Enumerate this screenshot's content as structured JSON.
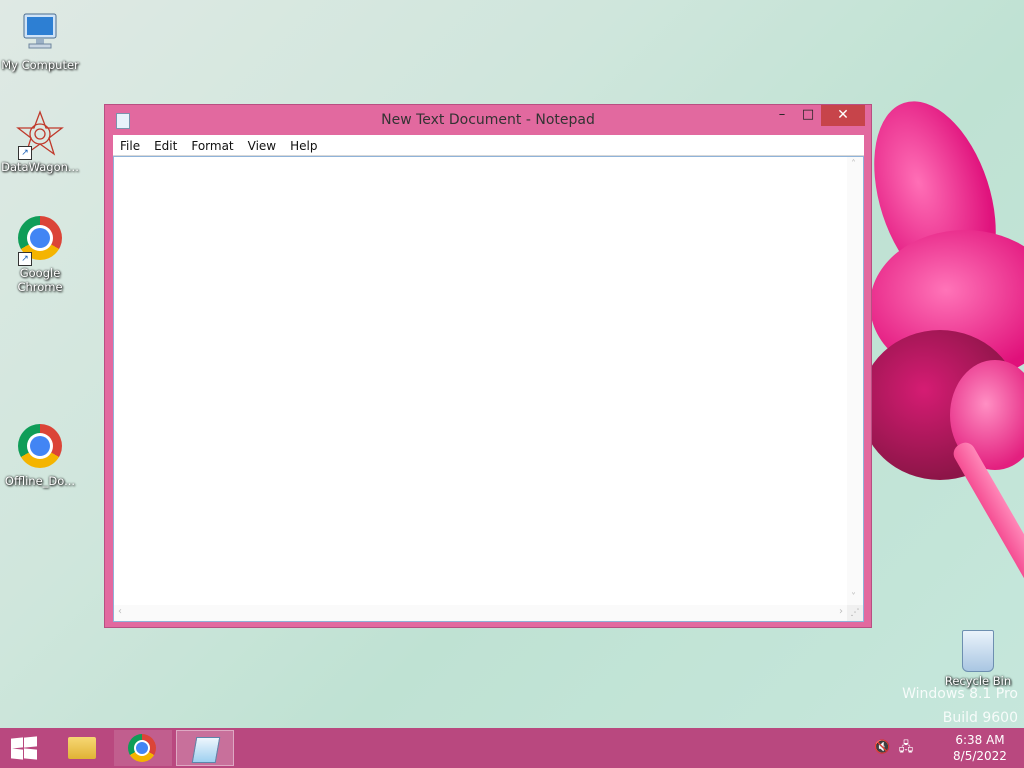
{
  "desktop": {
    "icons": [
      {
        "label": "My Computer",
        "icon": "computer-icon"
      },
      {
        "label": "DataWagon...",
        "icon": "datawagon-icon"
      },
      {
        "label": "Google Chrome",
        "icon": "chrome-icon"
      },
      {
        "label": "Offline_Do...",
        "icon": "chrome-icon"
      }
    ],
    "recycle_bin_label": "Recycle Bin",
    "watermark_line1": "Windows 8.1 Pro",
    "watermark_line2": "Build 9600"
  },
  "notepad": {
    "title": "New Text Document - Notepad",
    "menu": [
      "File",
      "Edit",
      "Format",
      "View",
      "Help"
    ],
    "content": "",
    "caption_buttons": {
      "minimize": "–",
      "maximize": "□",
      "close": "✕"
    }
  },
  "taskbar": {
    "items": [
      "start-button",
      "file-explorer",
      "google-chrome",
      "notepad"
    ],
    "clock_time": "6:38 AM",
    "clock_date": "8/5/2022",
    "tray_icons": [
      "volume-muted-icon",
      "network-icon"
    ]
  },
  "colors": {
    "window_frame": "#e2699f",
    "taskbar": "#b9487f",
    "close_button": "#c7444a"
  }
}
